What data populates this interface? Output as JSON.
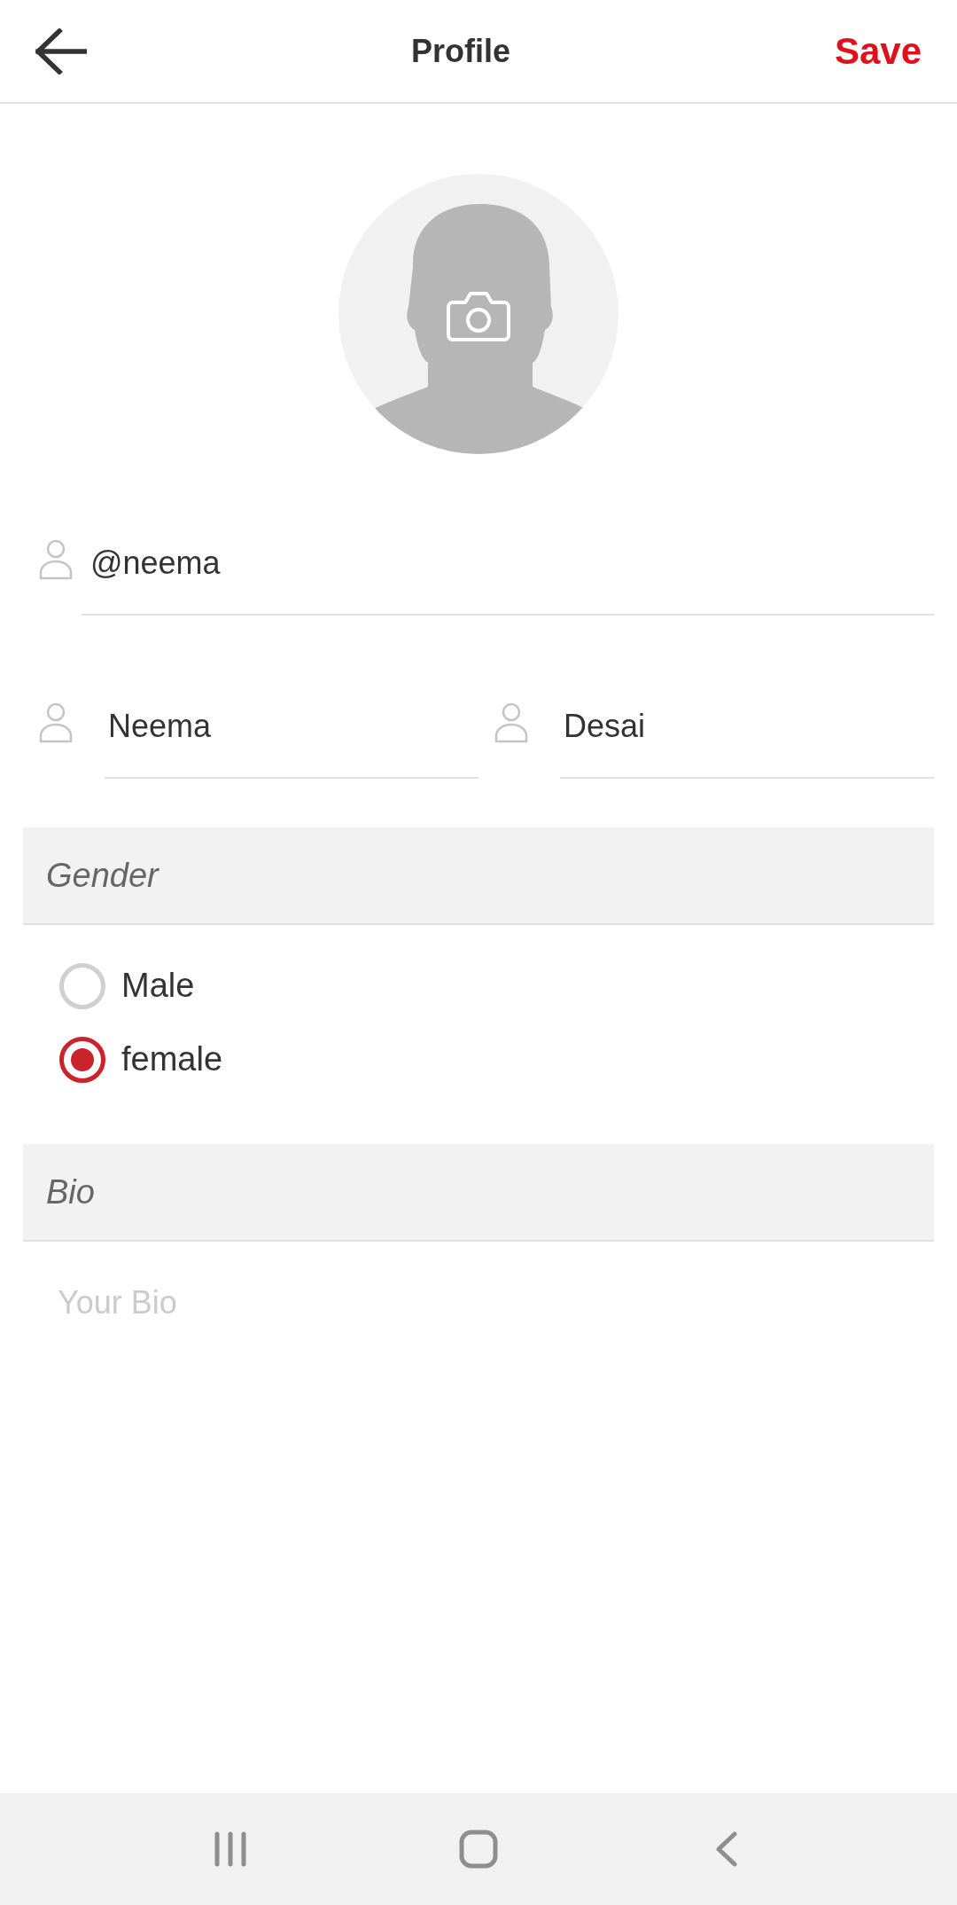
{
  "header": {
    "title": "Profile",
    "save_label": "Save"
  },
  "username": {
    "value": "@neema"
  },
  "name_fields": [
    {
      "value": "Neema"
    },
    {
      "value": "Desai"
    }
  ],
  "gender": {
    "heading": "Gender",
    "options": [
      {
        "label": "Male",
        "selected": false
      },
      {
        "label": "female",
        "selected": true
      }
    ]
  },
  "bio": {
    "heading": "Bio",
    "placeholder": "Your Bio"
  }
}
